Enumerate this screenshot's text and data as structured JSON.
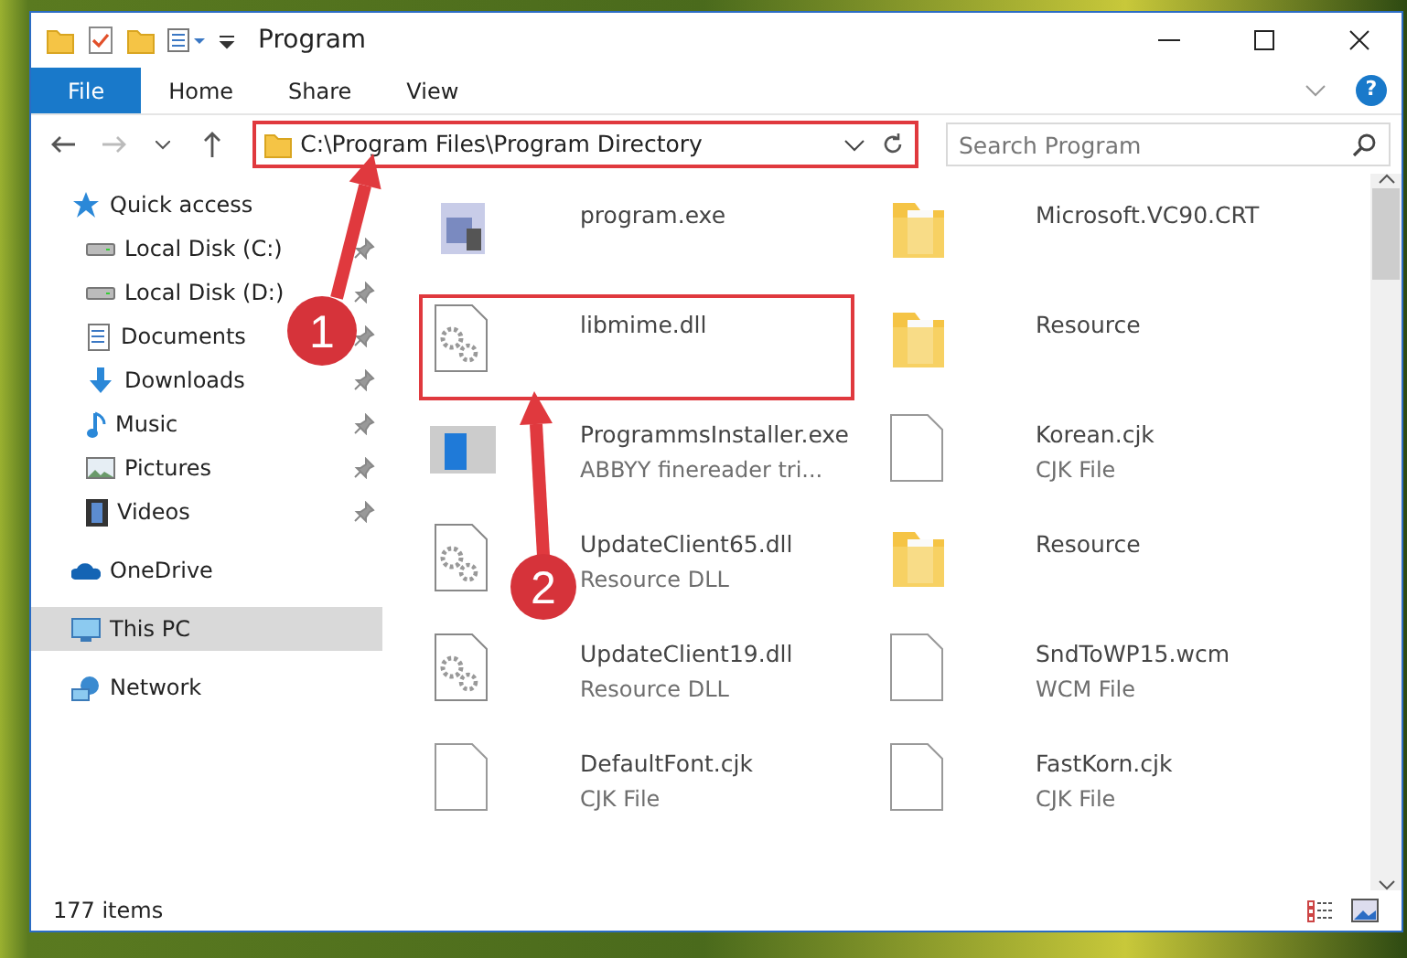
{
  "window": {
    "title": "Program"
  },
  "ribbon": {
    "tabs": [
      {
        "label": "File",
        "selected": true
      },
      {
        "label": "Home",
        "selected": false
      },
      {
        "label": "Share",
        "selected": false
      },
      {
        "label": "View",
        "selected": false
      }
    ],
    "help": "?"
  },
  "address_bar": {
    "path": "C:\\Program Files\\Program Directory",
    "outlined": true
  },
  "search": {
    "placeholder": "Search Program"
  },
  "sidebar": {
    "items": [
      {
        "label": "Quick access",
        "kind": "star",
        "selected": false,
        "children": [
          {
            "label": "Local Disk (C:)",
            "kind": "drive",
            "pinned": true,
            "selected": false
          },
          {
            "label": "Local Disk (D:)",
            "kind": "drive",
            "pinned": true,
            "selected": false
          },
          {
            "label": "Documents",
            "kind": "doc",
            "pinned": true,
            "selected": false
          },
          {
            "label": "Downloads",
            "kind": "download",
            "pinned": true,
            "selected": false
          },
          {
            "label": "Music",
            "kind": "music",
            "pinned": true,
            "selected": false
          },
          {
            "label": "Pictures",
            "kind": "pictures",
            "pinned": true,
            "selected": false
          },
          {
            "label": "Videos",
            "kind": "video",
            "pinned": true,
            "selected": false
          }
        ]
      },
      {
        "label": "OneDrive",
        "kind": "cloud",
        "selected": false
      },
      {
        "label": "This PC",
        "kind": "pc",
        "selected": true
      },
      {
        "label": "Network",
        "kind": "network",
        "selected": false
      }
    ]
  },
  "files": [
    {
      "name": "program.exe",
      "kind": "exe",
      "outlined": false
    },
    {
      "name": "Microsoft.VC90.CRT",
      "kind": "folder",
      "outlined": false
    },
    {
      "name": "libmime.dll",
      "kind": "dll",
      "outlined": true
    },
    {
      "name": "Resource",
      "kind": "folder",
      "outlined": false
    },
    {
      "name": "ProgrammsInstaller.exe",
      "detail": "ABBYY finereader tri...",
      "kind": "installer",
      "outlined": false
    },
    {
      "name": "Korean.cjk",
      "detail": "CJK File",
      "kind": "file",
      "outlined": false
    },
    {
      "name": "UpdateClient65.dll",
      "detail": "Resource DLL",
      "kind": "dll",
      "outlined": false
    },
    {
      "name": "Resource",
      "kind": "folder",
      "outlined": false
    },
    {
      "name": "UpdateClient19.dll",
      "detail": "Resource DLL",
      "kind": "dll",
      "outlined": false
    },
    {
      "name": "SndToWP15.wcm",
      "detail": "WCM File",
      "kind": "file",
      "outlined": false
    },
    {
      "name": "DefaultFont.cjk",
      "detail": "CJK File",
      "kind": "file",
      "outlined": false
    },
    {
      "name": "FastKorn.cjk",
      "detail": "CJK File",
      "kind": "file",
      "outlined": false
    }
  ],
  "status_bar": {
    "count": "177 items"
  },
  "callouts": [
    {
      "number": "1"
    },
    {
      "number": "2"
    }
  ]
}
